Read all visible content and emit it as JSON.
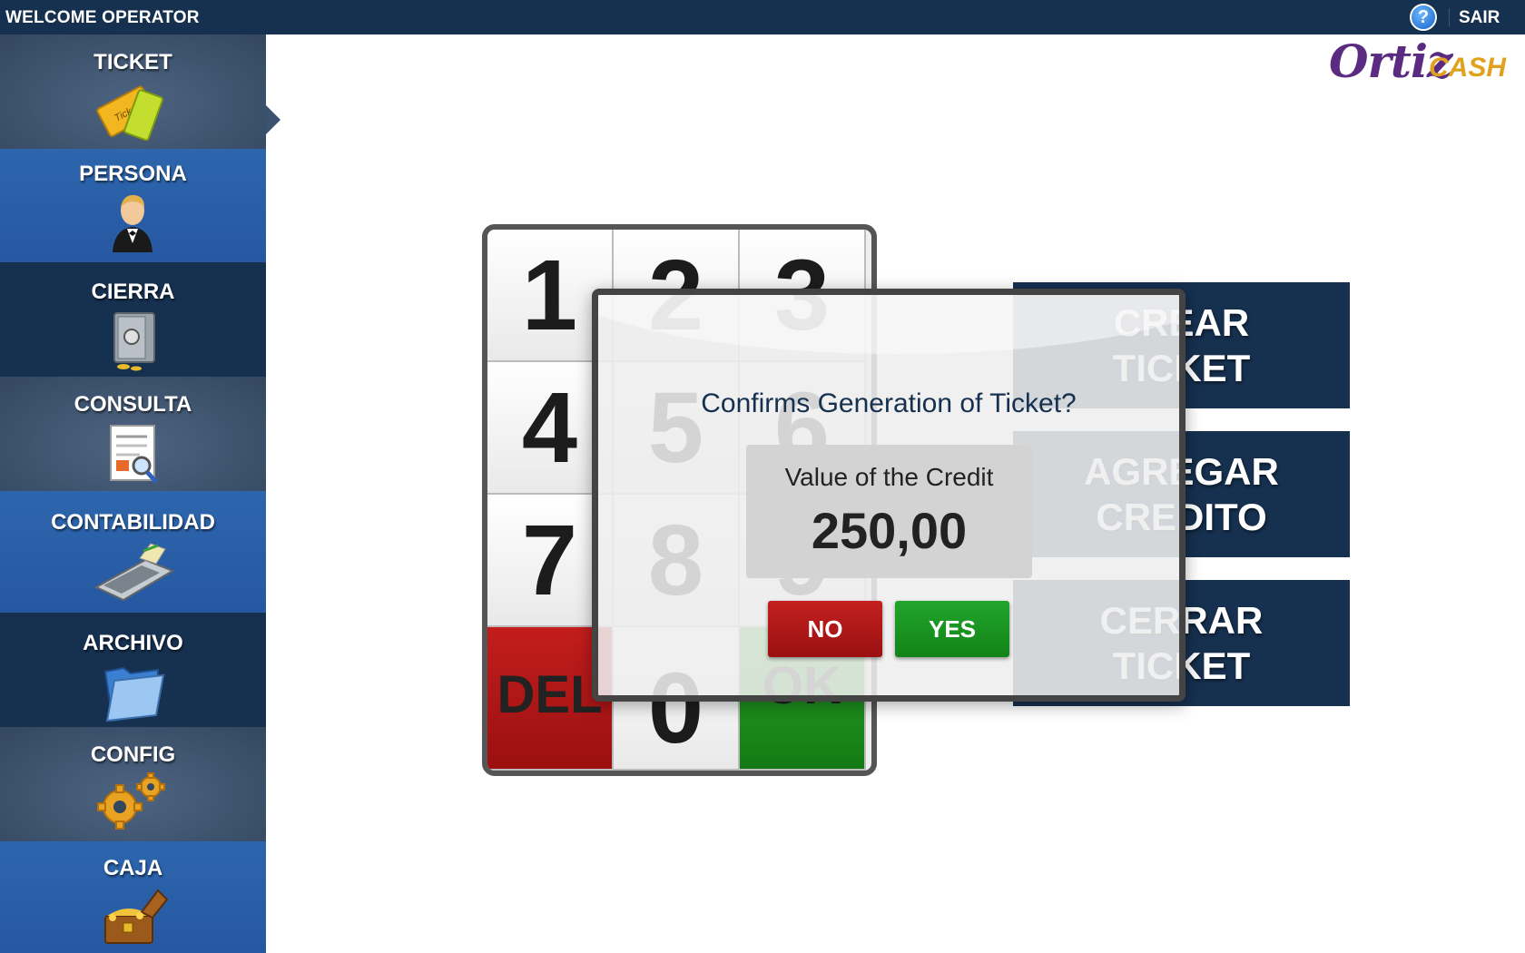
{
  "topbar": {
    "welcome": "WELCOME OPERATOR",
    "help_icon": "question-circle-icon",
    "help_glyph": "?",
    "logout": "SAIR"
  },
  "logo": {
    "name": "Ortiz",
    "suffix": "CASH"
  },
  "sidebar": {
    "active": "ticket",
    "items": [
      {
        "id": "ticket",
        "label": "TICKET",
        "icon": "ticket-icon"
      },
      {
        "id": "persona",
        "label": "PERSONA",
        "icon": "person-icon"
      },
      {
        "id": "cierra",
        "label": "CIERRA",
        "icon": "safe-icon"
      },
      {
        "id": "consulta",
        "label": "CONSULTA",
        "icon": "document-search-icon"
      },
      {
        "id": "contabilidad",
        "label": "CONTABILIDAD",
        "icon": "cash-register-icon"
      },
      {
        "id": "archivo",
        "label": "ARCHIVO",
        "icon": "folder-icon"
      },
      {
        "id": "config",
        "label": "CONFIG",
        "icon": "gears-icon"
      },
      {
        "id": "caja",
        "label": "CAJA",
        "icon": "treasure-chest-icon"
      }
    ]
  },
  "keypad": {
    "keys": [
      "1",
      "2",
      "3",
      "4",
      "5",
      "6",
      "7",
      "8",
      "9",
      "DEL",
      "0",
      "OK"
    ]
  },
  "actions": [
    {
      "line1": "CREAR",
      "line2": "TICKET"
    },
    {
      "line1": "AGREGAR",
      "line2": "CREDITO"
    },
    {
      "line1": "CERRAR",
      "line2": "TICKET"
    }
  ],
  "dialog": {
    "title": "Confirms Generation of Ticket?",
    "credit_label": "Value of the Credit",
    "credit_value": "250,00",
    "no_label": "NO",
    "yes_label": "YES"
  },
  "colors": {
    "navy": "#16304f",
    "sidebar_blue": "#2a5fa8",
    "danger": "#b51919",
    "success": "#1f9a26",
    "logo_purple": "#5b2b82",
    "logo_gold": "#e0a21d"
  }
}
